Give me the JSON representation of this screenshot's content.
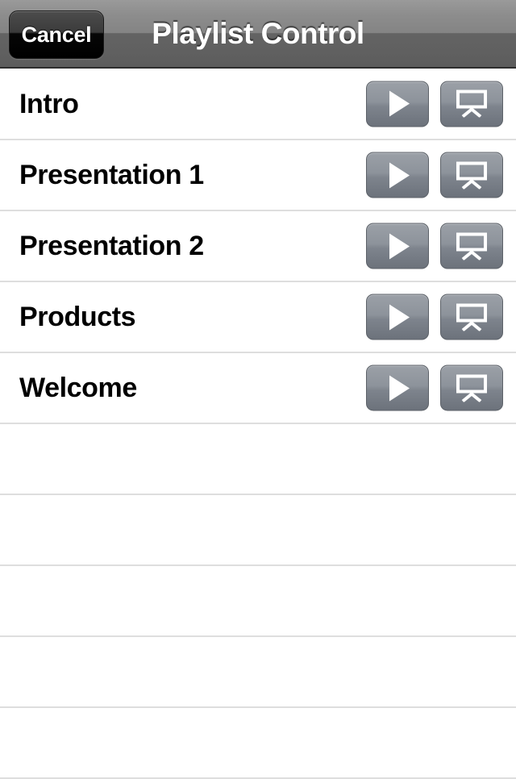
{
  "navbar": {
    "cancel_label": "Cancel",
    "title": "Playlist Control",
    "gradient_top": "#9a9a9a",
    "gradient_bottom": "#5c5c5c",
    "title_color": "#ffffff"
  },
  "list": {
    "separator_color": "#dedede",
    "background": "#ffffff",
    "items": [
      {
        "title": "Intro",
        "play_label": "play-icon",
        "present_label": "projector-icon"
      },
      {
        "title": "Presentation 1",
        "play_label": "play-icon",
        "present_label": "projector-icon"
      },
      {
        "title": "Presentation 2",
        "play_label": "play-icon",
        "present_label": "projector-icon"
      },
      {
        "title": "Products",
        "play_label": "play-icon",
        "present_label": "projector-icon"
      },
      {
        "title": "Welcome",
        "play_label": "play-icon",
        "present_label": "projector-icon"
      }
    ],
    "empty_rows": 5,
    "button_gradient_top": "#9ba0a7",
    "button_gradient_bottom": "#6c727b",
    "button_glyph_color": "#ffffff"
  }
}
